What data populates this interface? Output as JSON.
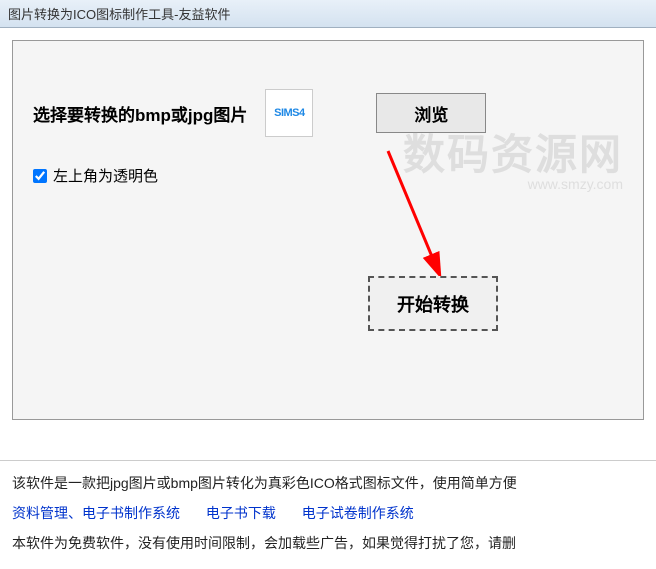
{
  "window": {
    "title": "图片转换为ICO图标制作工具-友益软件"
  },
  "main": {
    "select_label": "选择要转换的bmp或jpg图片",
    "preview_text": "SIMS4",
    "browse_button": "浏览",
    "checkbox_label": "左上角为透明色",
    "checkbox_checked": true,
    "convert_button": "开始转换"
  },
  "watermark": {
    "text": "数码资源网",
    "url": "www.smzy.com"
  },
  "footer": {
    "desc_line1": "该软件是一款把jpg图片或bmp图片转化为真彩色ICO格式图标文件，使用简单方便",
    "links": [
      "资料管理、电子书制作系统",
      "电子书下载",
      "电子试卷制作系统"
    ],
    "desc_line3": "本软件为免费软件，没有使用时间限制，会加载些广告，如果觉得打扰了您，请删"
  }
}
